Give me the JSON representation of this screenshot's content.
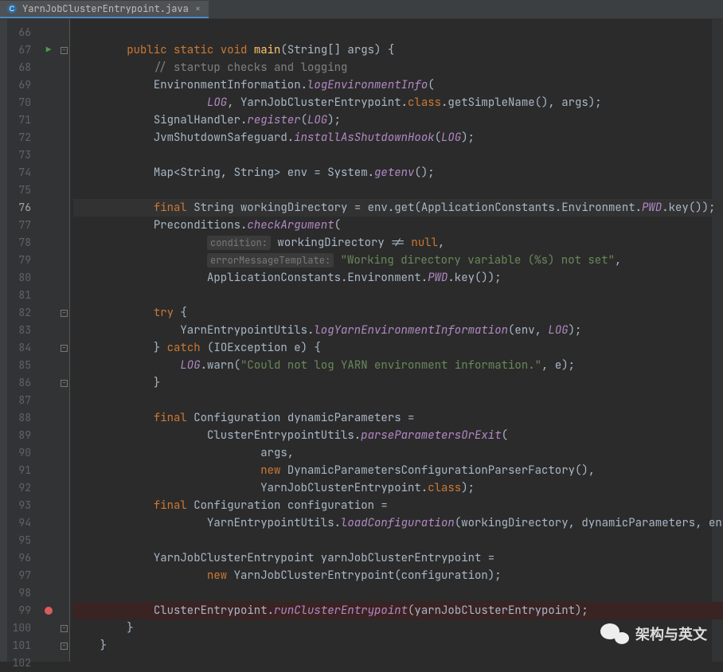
{
  "tab": {
    "filename": "YarnJobClusterEntrypoint.java",
    "close": "×"
  },
  "gutter": {
    "run_tooltip": "Run main",
    "breakpoint_line": 99
  },
  "lines": {
    "start": 66,
    "end": 102
  },
  "code": {
    "l67": {
      "indent": "        ",
      "kw1": "public static void ",
      "method": "main",
      "rest1": "(String[] args) {"
    },
    "l68": {
      "indent": "            ",
      "comment": "// startup checks and logging"
    },
    "l69": {
      "indent": "            ",
      "t1": "EnvironmentInformation.",
      "call": "logEnvironmentInfo",
      "t2": "("
    },
    "l70": {
      "indent": "                    ",
      "sf1": "LOG",
      "t1": ", YarnJobClusterEntrypoint.",
      "kw1": "class",
      "t2": ".getSimpleName(), args);"
    },
    "l71": {
      "indent": "            ",
      "t1": "SignalHandler.",
      "call": "register",
      "t2": "(",
      "sf1": "LOG",
      "t3": ");"
    },
    "l72": {
      "indent": "            ",
      "t1": "JvmShutdownSafeguard.",
      "call": "installAsShutdownHook",
      "t2": "(",
      "sf1": "LOG",
      "t3": ");"
    },
    "l74": {
      "indent": "            ",
      "t1": "Map<String, String> env = System.",
      "call": "getenv",
      "t2": "();"
    },
    "l76": {
      "indent": "            ",
      "kw1": "final ",
      "t1": "String workingDirectory = env.get(ApplicationConstants.Environment.",
      "sf1": "PWD",
      "t2": ".key());"
    },
    "l77": {
      "indent": "            ",
      "t1": "Preconditions.",
      "call": "checkArgument",
      "t2": "("
    },
    "l78": {
      "indent": "                    ",
      "hint": "condition:",
      "t1": " workingDirectory != ",
      "kw1": "null",
      "t2": ","
    },
    "l79": {
      "indent": "                    ",
      "hint": "errorMessageTemplate:",
      "t1": " ",
      "str": "\"Working directory variable (%s) not set\"",
      "t2": ","
    },
    "l80": {
      "indent": "                    ",
      "t1": "ApplicationConstants.Environment.",
      "sf1": "PWD",
      "t2": ".key());"
    },
    "l82": {
      "indent": "            ",
      "kw1": "try ",
      "t1": "{"
    },
    "l83": {
      "indent": "                ",
      "t1": "YarnEntrypointUtils.",
      "call": "logYarnEnvironmentInformation",
      "t2": "(env, ",
      "sf1": "LOG",
      "t3": ");"
    },
    "l84": {
      "indent": "            ",
      "t1": "} ",
      "kw1": "catch ",
      "t2": "(IOException e) {"
    },
    "l85": {
      "indent": "                ",
      "sf1": "LOG",
      "t1": ".warn(",
      "str": "\"Could not log YARN environment information.\"",
      "t2": ", e);"
    },
    "l86": {
      "indent": "            ",
      "t1": "}"
    },
    "l88": {
      "indent": "            ",
      "kw1": "final ",
      "t1": "Configuration dynamicParameters ="
    },
    "l89": {
      "indent": "                    ",
      "t1": "ClusterEntrypointUtils.",
      "call": "parseParametersOrExit",
      "t2": "("
    },
    "l90": {
      "indent": "                            ",
      "t1": "args,"
    },
    "l91": {
      "indent": "                            ",
      "kw1": "new ",
      "t1": "DynamicParametersConfigurationParserFactory(),"
    },
    "l92": {
      "indent": "                            ",
      "t1": "YarnJobClusterEntrypoint.",
      "kw1": "class",
      "t2": ");"
    },
    "l93": {
      "indent": "            ",
      "kw1": "final ",
      "t1": "Configuration configuration ="
    },
    "l94": {
      "indent": "                    ",
      "t1": "YarnEntrypointUtils.",
      "call": "loadConfiguration",
      "t2": "(workingDirectory, dynamicParameters, env);"
    },
    "l96": {
      "indent": "            ",
      "t1": "YarnJobClusterEntrypoint yarnJobClusterEntrypoint ="
    },
    "l97": {
      "indent": "                    ",
      "kw1": "new ",
      "t1": "YarnJobClusterEntrypoint(configuration);"
    },
    "l99": {
      "indent": "            ",
      "t1": "ClusterEntrypoint.",
      "call": "runClusterEntrypoint",
      "t2": "(yarnJobClusterEntrypoint);"
    },
    "l100": {
      "indent": "        ",
      "t1": "}"
    },
    "l101": {
      "indent": "    ",
      "t1": "}"
    }
  },
  "watermark": {
    "text": "架构与英文"
  }
}
